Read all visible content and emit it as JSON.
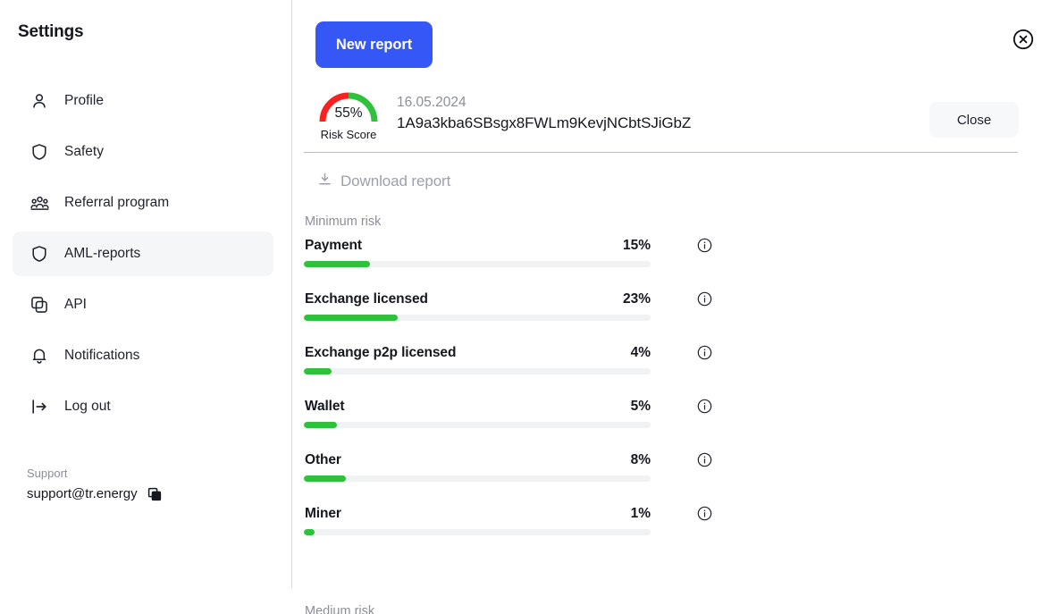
{
  "sidebar": {
    "title": "Settings",
    "items": [
      {
        "label": "Profile",
        "icon": "user-icon",
        "active": false
      },
      {
        "label": "Safety",
        "icon": "shield-icon",
        "active": false
      },
      {
        "label": "Referral program",
        "icon": "people-icon",
        "active": false
      },
      {
        "label": "AML-reports",
        "icon": "shield-icon",
        "active": true
      },
      {
        "label": "API",
        "icon": "api-copy-icon",
        "active": false
      },
      {
        "label": "Notifications",
        "icon": "bell-icon",
        "active": false
      },
      {
        "label": "Log out",
        "icon": "logout-icon",
        "active": false
      }
    ],
    "support": {
      "label": "Support",
      "email": "support@tr.energy",
      "copy_icon": "copy-icon"
    }
  },
  "main": {
    "new_report_label": "New report",
    "close_x_icon": "close-circle-icon",
    "close_label": "Close",
    "download_label": "Download report",
    "download_icon": "download-icon",
    "report": {
      "risk_score_value": "55%",
      "risk_score_caption": "Risk Score",
      "risk_score_percent": 55,
      "date": "16.05.2024",
      "address": "1A9a3kba6SBsgx8FWLm9KevjNCbtSJiGbZ"
    },
    "groups": [
      {
        "label": "Minimum risk",
        "rows": [
          {
            "name": "Payment",
            "pct_label": "15%",
            "value": 15,
            "bar_fill": 19,
            "info_icon": "info-icon"
          },
          {
            "name": "Exchange licensed",
            "pct_label": "23%",
            "value": 23,
            "bar_fill": 27,
            "info_icon": "info-icon"
          },
          {
            "name": "Exchange p2p licensed",
            "pct_label": "4%",
            "value": 4,
            "bar_fill": 8,
            "info_icon": "info-icon"
          },
          {
            "name": "Wallet",
            "pct_label": "5%",
            "value": 5,
            "bar_fill": 9.5,
            "info_icon": "info-icon"
          },
          {
            "name": "Other",
            "pct_label": "8%",
            "value": 8,
            "bar_fill": 12,
            "info_icon": "info-icon"
          },
          {
            "name": "Miner",
            "pct_label": "1%",
            "value": 1,
            "bar_fill": 3,
            "info_icon": "info-icon"
          }
        ]
      }
    ],
    "next_group_label": "Medium risk"
  },
  "colors": {
    "accent_blue": "#3457f5",
    "bar_green": "#2ec13c",
    "gauge_red": "#f82020",
    "gauge_green": "#2ec13c",
    "muted_text": "#8b8f98",
    "active_bg": "#f5f6f8"
  },
  "chart_data": {
    "type": "bar",
    "title": "Minimum risk",
    "orientation": "horizontal",
    "categories": [
      "Payment",
      "Exchange licensed",
      "Exchange p2p licensed",
      "Wallet",
      "Other",
      "Miner"
    ],
    "values": [
      15,
      23,
      4,
      5,
      8,
      1
    ],
    "unit": "%",
    "xlabel": "",
    "ylabel": "",
    "ylim": [
      0,
      100
    ],
    "grid": false,
    "legend": "none",
    "series_color": "#2ec13c"
  }
}
